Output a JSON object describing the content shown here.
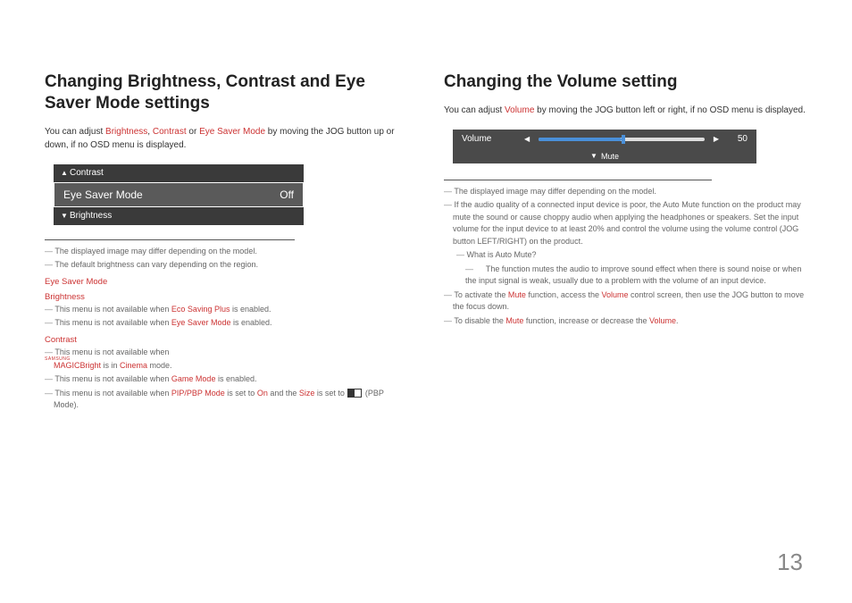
{
  "left": {
    "title": "Changing Brightness, Contrast and Eye Saver Mode settings",
    "intro_pre": "You can adjust ",
    "kw1": "Brightness",
    "sep1": ", ",
    "kw2": "Contrast",
    "sep2": " or ",
    "kw3": "Eye Saver Mode",
    "intro_post": " by moving the JOG button up or down, if no OSD menu is displayed.",
    "osd": {
      "contrast": "Contrast",
      "main_label": "Eye Saver Mode",
      "main_value": "Off",
      "brightness": "Brightness"
    },
    "notes1": {
      "n1": "The displayed image may differ depending on the model.",
      "n2": "The default brightness can vary depending on the region."
    },
    "sub1": "Eye Saver Mode",
    "sub2": "Brightness",
    "b_notes": {
      "n1_pre": "This menu is not available when ",
      "n1_kw": "Eco Saving Plus",
      "n1_post": " is enabled.",
      "n2_pre": "This menu is not available when ",
      "n2_kw": "Eye Saver Mode",
      "n2_post": " is enabled."
    },
    "sub3": "Contrast",
    "c_notes": {
      "n1_pre": "This menu is not available when ",
      "n1_magic_sup": "SAMSUNG",
      "n1_magic": "MAGICBright",
      "n1_mid": " is in ",
      "n1_kw": "Cinema",
      "n1_post": " mode.",
      "n2_pre": "This menu is not available when ",
      "n2_kw": "Game Mode",
      "n2_post": " is enabled.",
      "n3_pre": "This menu is not available when ",
      "n3_kw1": "PIP/PBP Mode",
      "n3_mid1": " is set to ",
      "n3_kw2": "On",
      "n3_mid2": " and the ",
      "n3_kw3": "Size",
      "n3_mid3": " is set to ",
      "n3_post": " (PBP Mode)."
    }
  },
  "right": {
    "title": "Changing the Volume setting",
    "intro_pre": "You can adjust ",
    "kw1": "Volume",
    "intro_post": " by moving the JOG button left or right, if no OSD menu is displayed.",
    "vol": {
      "label": "Volume",
      "value": "50",
      "mute": "Mute"
    },
    "notes": {
      "n1": "The displayed image may differ depending on the model.",
      "n2": "If the audio quality of a connected input device is poor, the Auto Mute function on the product may mute the sound or cause choppy audio when applying the headphones or speakers. Set the input volume for the input device to at least 20% and control the volume using the volume control (JOG button LEFT/RIGHT) on the product.",
      "n3a": "What is Auto Mute?",
      "n3b": "The function mutes the audio to improve sound effect when there is sound noise or when the input signal is weak, usually due to a problem with the volume of an input device.",
      "n4_pre": "To activate the ",
      "n4_kw1": "Mute",
      "n4_mid1": " function, access the ",
      "n4_kw2": "Volume",
      "n4_post": " control screen, then use the JOG button to move the focus down.",
      "n5_pre": "To disable the ",
      "n5_kw1": "Mute",
      "n5_mid": " function, increase or decrease the ",
      "n5_kw2": "Volume",
      "n5_post": "."
    }
  },
  "page_number": "13"
}
